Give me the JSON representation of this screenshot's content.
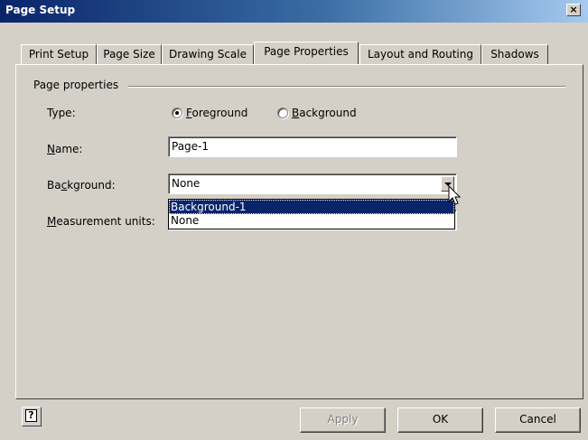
{
  "window": {
    "title": "Page Setup",
    "close_glyph": "×"
  },
  "tabs": [
    {
      "label": "Print Setup"
    },
    {
      "label": "Page Size"
    },
    {
      "label": "Drawing Scale"
    },
    {
      "label": "Page Properties",
      "active": true
    },
    {
      "label": "Layout and Routing"
    },
    {
      "label": "Shadows"
    }
  ],
  "group": {
    "title": "Page properties"
  },
  "type_row": {
    "label": "Type:",
    "options": [
      {
        "label": "Foreground",
        "selected": true
      },
      {
        "label": "Background",
        "selected": false
      }
    ]
  },
  "name_row": {
    "label": "Name:",
    "value": "Page-1"
  },
  "background_row": {
    "label": "Background:",
    "value": "None",
    "dropdown_options": [
      "Background-1",
      "None"
    ],
    "highlighted_option": "Background-1"
  },
  "measurement_row": {
    "label": "Measurement units:"
  },
  "buttons": {
    "apply": "Apply",
    "ok": "OK",
    "cancel": "Cancel",
    "help_glyph": "?"
  },
  "colors": {
    "titlebar": "#0a246a",
    "face": "#d4d0c8",
    "selection": "#0a246a"
  }
}
